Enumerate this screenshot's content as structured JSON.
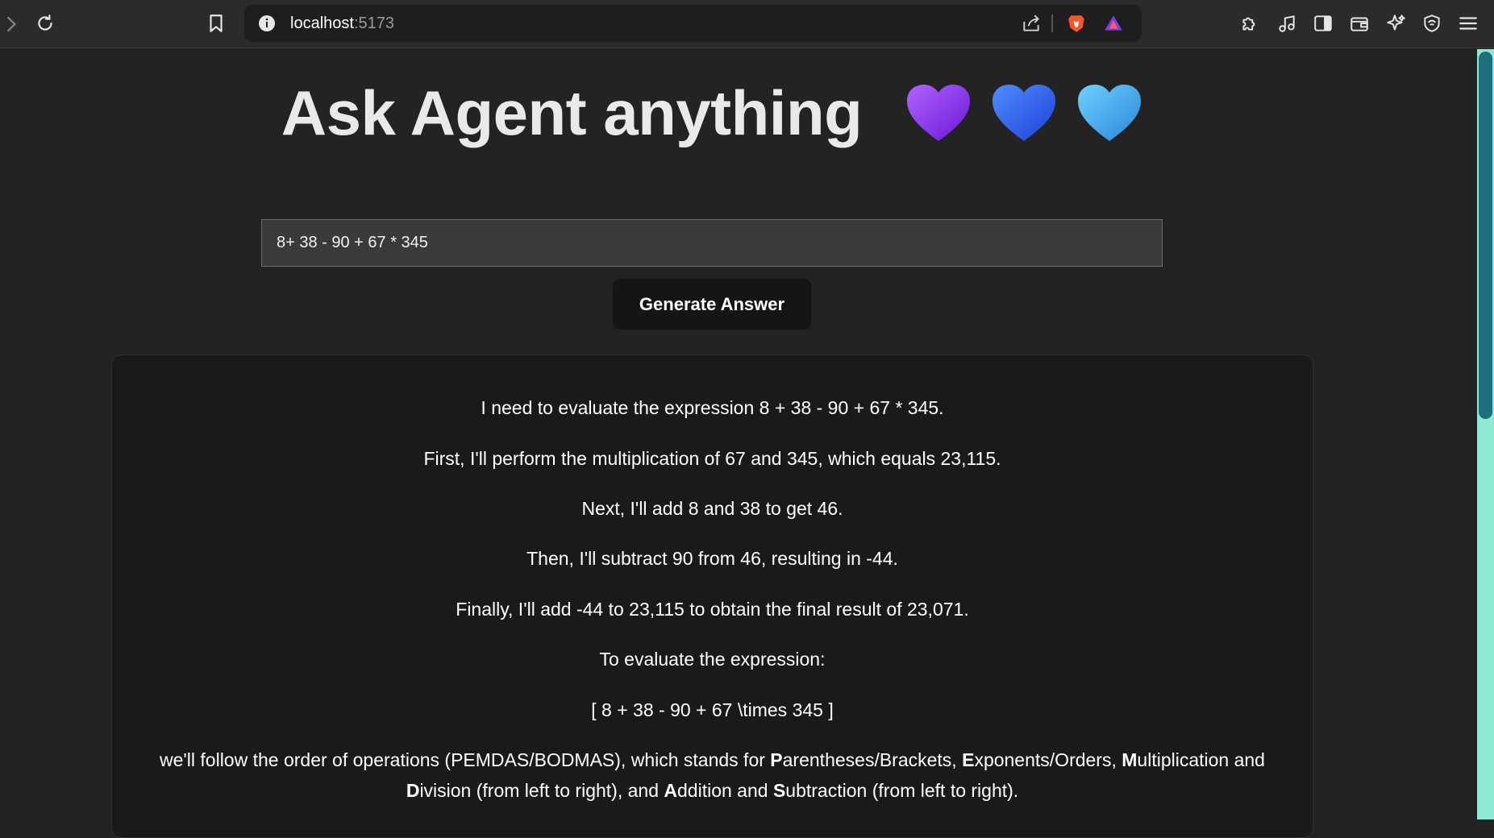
{
  "browser": {
    "url_host": "localhost",
    "url_port": ":5173"
  },
  "page": {
    "title": "Ask Agent anything",
    "hearts": [
      "purple-heart",
      "blue-heart",
      "light-blue-heart"
    ],
    "question": {
      "value": "8+ 38 - 90 + 67 * 345"
    },
    "generate_label": "Generate Answer",
    "answer": {
      "lines": [
        "I need to evaluate the expression 8 + 38 - 90 + 67 * 345.",
        "First, I'll perform the multiplication of 67 and 345, which equals 23,115.",
        "Next, I'll add 8 and 38 to get 46.",
        "Then, I'll subtract 90 from 46, resulting in -44.",
        "Finally, I'll add -44 to 23,115 to obtain the final result of 23,071.",
        "To evaluate the expression:",
        "[ 8 + 38 - 90 + 67 \\times 345 ]"
      ],
      "pemdas": {
        "intro": "we'll follow the order of operations (PEMDAS/BODMAS), which stands for ",
        "p_bold": "P",
        "p_rest": "arentheses/Brackets, ",
        "e_bold": "E",
        "e_rest": "xponents/Orders, ",
        "m_bold": "M",
        "m_rest": "ultiplication and",
        "d_bold": "D",
        "d_rest": "ivision (from left to right), and ",
        "a_bold": "A",
        "a_rest": "ddition and ",
        "s_bold": "S",
        "s_rest": "ubtraction (from left to right)."
      }
    }
  },
  "colors": {
    "page_background": "#232323",
    "panel_background": "#1a1a1a",
    "button_background": "#151515",
    "scrollbar_track": "#8de9d2",
    "scrollbar_thumb": "#1f6f7c"
  }
}
